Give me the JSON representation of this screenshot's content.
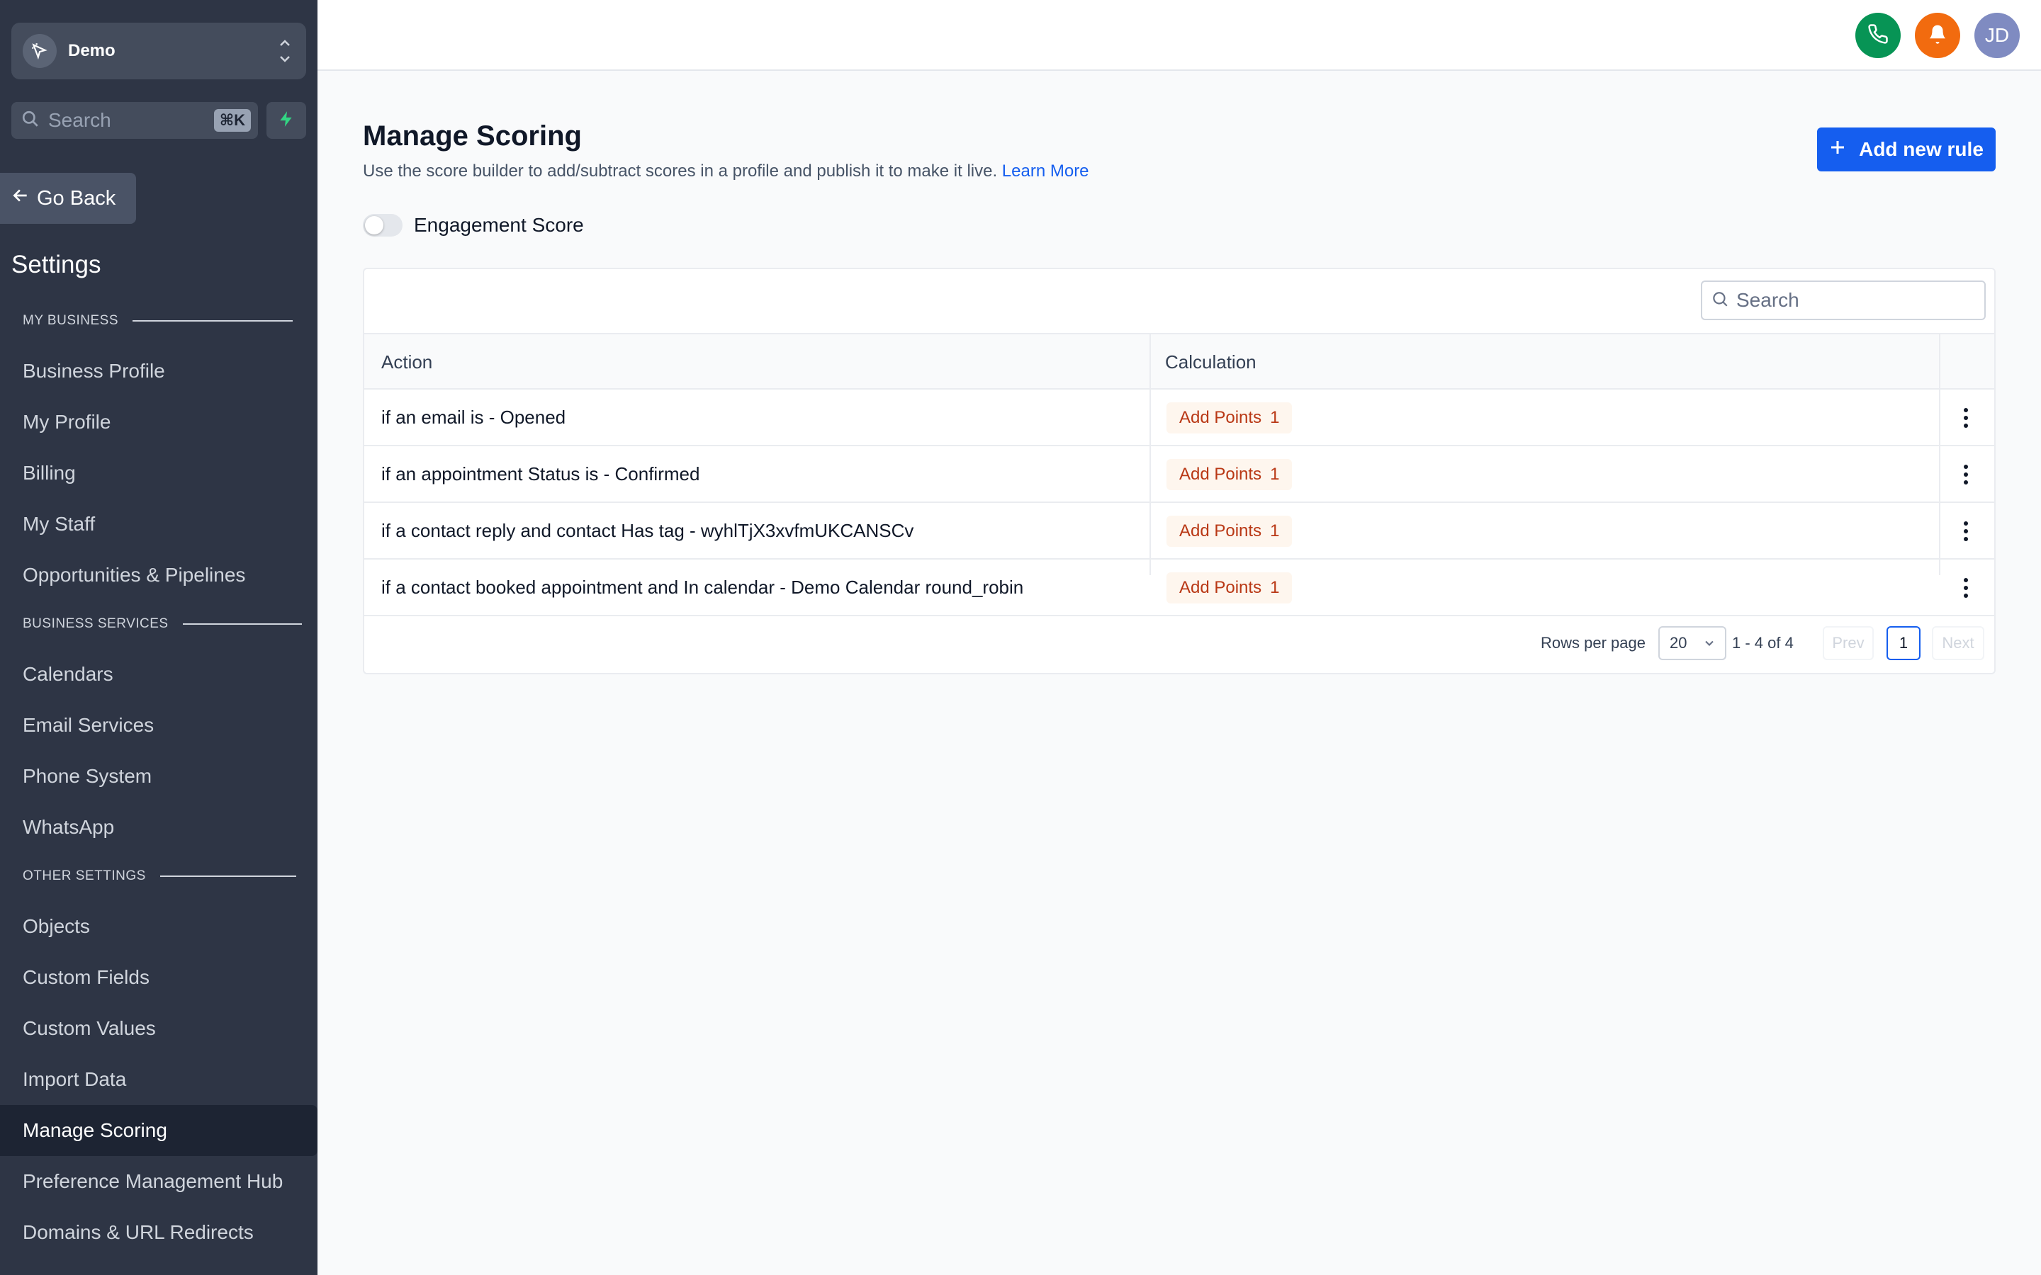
{
  "sidebar": {
    "account_name": "Demo",
    "search_placeholder": "Search",
    "search_shortcut": "⌘K",
    "go_back_label": "Go Back",
    "settings_title": "Settings",
    "sections": [
      {
        "label": "MY BUSINESS",
        "items": [
          "Business Profile",
          "My Profile",
          "Billing",
          "My Staff",
          "Opportunities & Pipelines"
        ]
      },
      {
        "label": "BUSINESS SERVICES",
        "items": [
          "Calendars",
          "Email Services",
          "Phone System",
          "WhatsApp"
        ]
      },
      {
        "label": "OTHER SETTINGS",
        "items": [
          "Objects",
          "Custom Fields",
          "Custom Values",
          "Import Data",
          "Manage Scoring",
          "Preference Management Hub",
          "Domains & URL Redirects"
        ]
      }
    ],
    "active_item": "Manage Scoring"
  },
  "topbar": {
    "avatar_initials": "JD",
    "phone_color": "#079455",
    "bell_color": "#f26b0f"
  },
  "main": {
    "title": "Manage Scoring",
    "description": "Use the score builder to add/subtract scores in a profile and publish it to make it live.",
    "learn_more": "Learn More",
    "add_button": "Add new rule",
    "toggle_label": "Engagement Score",
    "toggle_on": false
  },
  "table": {
    "search_placeholder": "Search",
    "columns": [
      "Action",
      "Calculation"
    ],
    "rows": [
      {
        "action": "if an email is - Opened",
        "calc_label": "Add Points",
        "points": "1"
      },
      {
        "action": "if an appointment Status is - Confirmed",
        "calc_label": "Add Points",
        "points": "1"
      },
      {
        "action": "if a contact reply and contact Has tag - wyhlTjX3xvfmUKCANSCv",
        "calc_label": "Add Points",
        "points": "1"
      },
      {
        "action": "if a contact booked appointment and In calendar - Demo Calendar round_robin",
        "calc_label": "Add Points",
        "points": "1"
      }
    ],
    "pagination": {
      "rows_per_page_label": "Rows per page",
      "rows_per_page": "20",
      "range": "1 - 4 of 4",
      "prev": "Prev",
      "current_page": "1",
      "next": "Next"
    }
  }
}
